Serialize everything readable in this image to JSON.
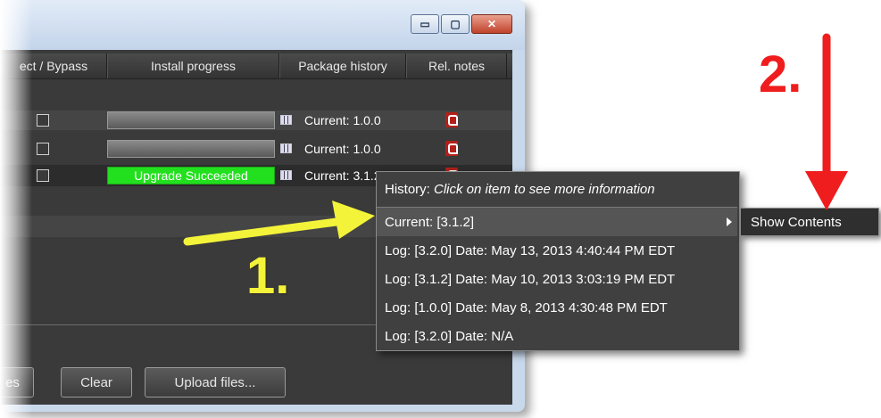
{
  "window": {
    "controls": {
      "minimize": "▭",
      "maximize": "▢",
      "close": "✕"
    }
  },
  "columns": [
    "ect / Bypass",
    "Install progress",
    "Package history",
    "Rel. notes"
  ],
  "rows": [
    {
      "progress": "",
      "history": "Current: 1.0.0",
      "icon": "grid-icon",
      "notes_icon": "pdf-icon"
    },
    {
      "progress": "",
      "history": "Current: 1.0.0",
      "icon": "grid-icon",
      "notes_icon": "pdf-icon"
    },
    {
      "progress": "Upgrade Succeeded",
      "history": "Current: 3.1.2",
      "icon": "grid-icon",
      "notes_icon": "pdf-icon"
    }
  ],
  "buttons": {
    "partial": "es",
    "clear": "Clear",
    "upload": "Upload files..."
  },
  "menu": {
    "header_prefix": "History: ",
    "header_hint": "Click on item to see more information",
    "items": [
      "Current: [3.1.2]",
      "Log: [3.2.0] Date: May 13, 2013 4:40:44 PM EDT",
      "Log: [3.1.2] Date: May 10, 2013 3:03:19 PM EDT",
      "Log: [1.0.0] Date: May 8, 2013 4:30:48 PM EDT",
      "Log: [3.2.0] Date: N/A"
    ],
    "submenu": "Show Contents"
  },
  "annotations": {
    "step1": "1.",
    "step2": "2."
  },
  "colors": {
    "success": "#22e01e",
    "annotation_yellow": "#f3f33a",
    "annotation_red": "#ef1d1d"
  }
}
